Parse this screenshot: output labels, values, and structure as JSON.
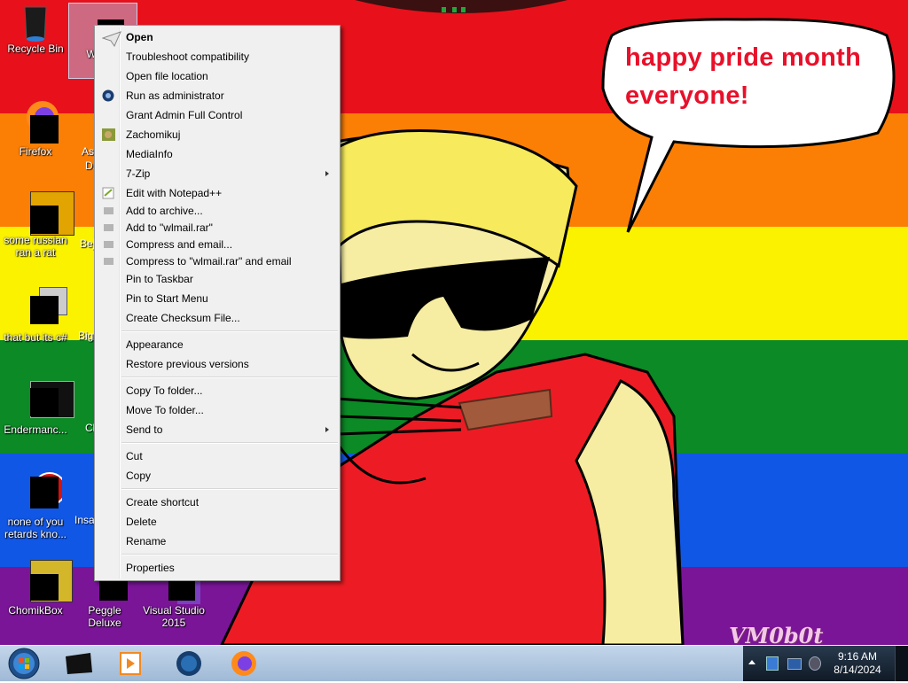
{
  "desktop": {
    "icons": [
      {
        "label": "Recycle Bin"
      },
      {
        "label": "Wind..."
      },
      {
        "label": "Firefox"
      },
      {
        "label": "As..."
      },
      {
        "label": "D..."
      },
      {
        "label": "some russian ran a rat"
      },
      {
        "label": "Bej..."
      },
      {
        "label": "that but its c#"
      },
      {
        "label": "Big..."
      },
      {
        "label": "Endermanc..."
      },
      {
        "label": "Cl..."
      },
      {
        "label": "none of you retards kno..."
      },
      {
        "label": "Insa..."
      },
      {
        "label": "ChomikBox"
      },
      {
        "label": "Peggle Deluxe"
      },
      {
        "label": "Visual Studio 2015"
      }
    ],
    "speech_bubble": {
      "line1": "happy pride month",
      "line2": "everyone!"
    },
    "watermark": "VM0b0t",
    "colors": {
      "red": "#e8111b",
      "orange": "#fc7f05",
      "yellow": "#fbf200",
      "green": "#0b8a25",
      "blue": "#1157e6",
      "purple": "#7a1598"
    }
  },
  "context_menu": {
    "items": {
      "open": "Open",
      "troubleshoot": "Troubleshoot compatibility",
      "open_location": "Open file location",
      "run_admin": "Run as administrator",
      "grant_admin": "Grant Admin Full Control",
      "zachomikuj": "Zachomikuj",
      "mediainfo": "MediaInfo",
      "sevenzip": "7-Zip",
      "notepadpp": "Edit with Notepad++",
      "add_archive": "Add to archive...",
      "add_rar": "Add to \"wlmail.rar\"",
      "compress_email": "Compress and email...",
      "compress_rar_email": "Compress to \"wlmail.rar\" and email",
      "pin_taskbar": "Pin to Taskbar",
      "pin_start": "Pin to Start Menu",
      "checksum": "Create Checksum File...",
      "appearance": "Appearance",
      "restore": "Restore previous versions",
      "copy_folder": "Copy To folder...",
      "move_folder": "Move To folder...",
      "send_to": "Send to",
      "cut": "Cut",
      "copy": "Copy",
      "create_shortcut": "Create shortcut",
      "delete": "Delete",
      "rename": "Rename",
      "properties": "Properties"
    }
  },
  "taskbar": {
    "clock": {
      "time": "9:16 AM",
      "date": "8/14/2024"
    },
    "pinned": [
      "start-orb-icon",
      "media-center-icon",
      "media-player-icon",
      "globe-icon",
      "firefox-icon"
    ]
  }
}
